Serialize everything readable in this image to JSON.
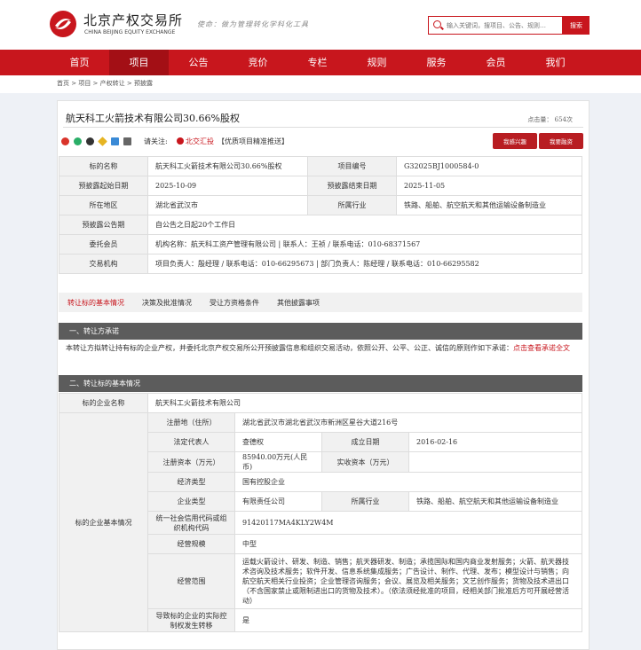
{
  "header": {
    "logo_cn": "北京产权交易所",
    "logo_en": "CHINA BEIJING EQUITY EXCHANGE",
    "slogan": "使命：做为管理转化学科化工具",
    "search_placeholder": "输入关键词，搜项目、公告、规则…",
    "search_button": "搜索"
  },
  "nav": {
    "items": [
      "首页",
      "项目",
      "公告",
      "竞价",
      "专栏",
      "规则",
      "服务",
      "会员",
      "我们"
    ],
    "active_index": 1
  },
  "breadcrumb": "首页 > 项目 > 产权转让 > 预披露",
  "project": {
    "title": "航天科工火箭技术有限公司30.66%股权",
    "clicks": "点击量： 654次",
    "follow_label": "请关注:",
    "follow_tag": "北交汇投",
    "follow_desc": "【优质项目精准推送】",
    "btn_interest": "我感兴趣",
    "btn_finance": "我要融资"
  },
  "info": {
    "rows": [
      {
        "l1": "标的名称",
        "v1": "航天科工火箭技术有限公司30.66%股权",
        "l2": "项目编号",
        "v2": "G32025BJ1000584-0"
      },
      {
        "l1": "预披露起始日期",
        "v1": "2025-10-09",
        "l2": "预披露结束日期",
        "v2": "2025-11-05"
      },
      {
        "l1": "所在地区",
        "v1": "湖北省武汉市",
        "l2": "所属行业",
        "v2": "铁路、船舶、航空航天和其他运输设备制造业"
      }
    ],
    "announce_label": "预披露公告期",
    "announce_value": "自公告之日起20个工作日",
    "agent_label": "委托会员",
    "agent_value": "机构名称：航天科工资产管理有限公司 | 联系人：王祯 / 联系电话：010-68371567",
    "exchange_label": "交易机构",
    "exchange_value": "项目负责人：殷经理 / 联系电话：010-66295673 | 部门负责人：陈经理 / 联系电话：010-66295582"
  },
  "tabs": [
    "转让标的基本情况",
    "决策及批准情况",
    "受让方资格条件",
    "其他披露事项"
  ],
  "section1": {
    "title": "一、转让方承诺",
    "text": "本转让方拟转让持有标的企业产权，并委托北京产权交易所公开预披露信息和组织交易活动，依照公开、公平、公正、诚信的原则作如下承诺：",
    "link": "点击查看承诺全文"
  },
  "section2": {
    "title": "二、转让标的基本情况",
    "company_label": "标的企业名称",
    "company_value": "航天科工火箭技术有限公司",
    "basic_label": "标的企业基本情况",
    "address_label": "注册地（住所）",
    "address_value": "湖北省武汉市湖北省武汉市新洲区星谷大道216号",
    "legal_label": "法定代表人",
    "legal_value": "查德权",
    "found_label": "成立日期",
    "found_value": "2016-02-16",
    "capital_label": "注册资本（万元）",
    "capital_value": "85940.00万元(人民币)",
    "paid_label": "实收资本（万元）",
    "paid_value": "",
    "econ_label": "经济类型",
    "econ_value": "国有控股企业",
    "type_label": "企业类型",
    "type_value": "有限责任公司",
    "industry_label": "所属行业",
    "industry_value": "铁路、船舶、航空航天和其他运输设备制造业",
    "credit_label": "统一社会信用代码或组织机构代码",
    "credit_value": "91420117MA4KLY2W4M",
    "scale_label": "经营规模",
    "scale_value": "中型",
    "scope_label": "经营范围",
    "scope_value": "运载火箭设计、研发、制造、销售；航天器研发、制造；承揽国际和国内商业发射服务；火箭、航天器技术咨询及技术服务；软件开发、信息系统集成服务；广告设计、制作、代理、发布；模型设计与销售；向航空航天相关行业投资；企业管理咨询服务；会议、展览及相关服务；文艺创作服务；货物及技术进出口（不含国家禁止或限制进出口的货物及技术）。（依法须经批准的项目，经相关部门批准后方可开展经营活动）",
    "control_label": "导致标的企业的实际控制权发生转移",
    "control_value": "是"
  }
}
